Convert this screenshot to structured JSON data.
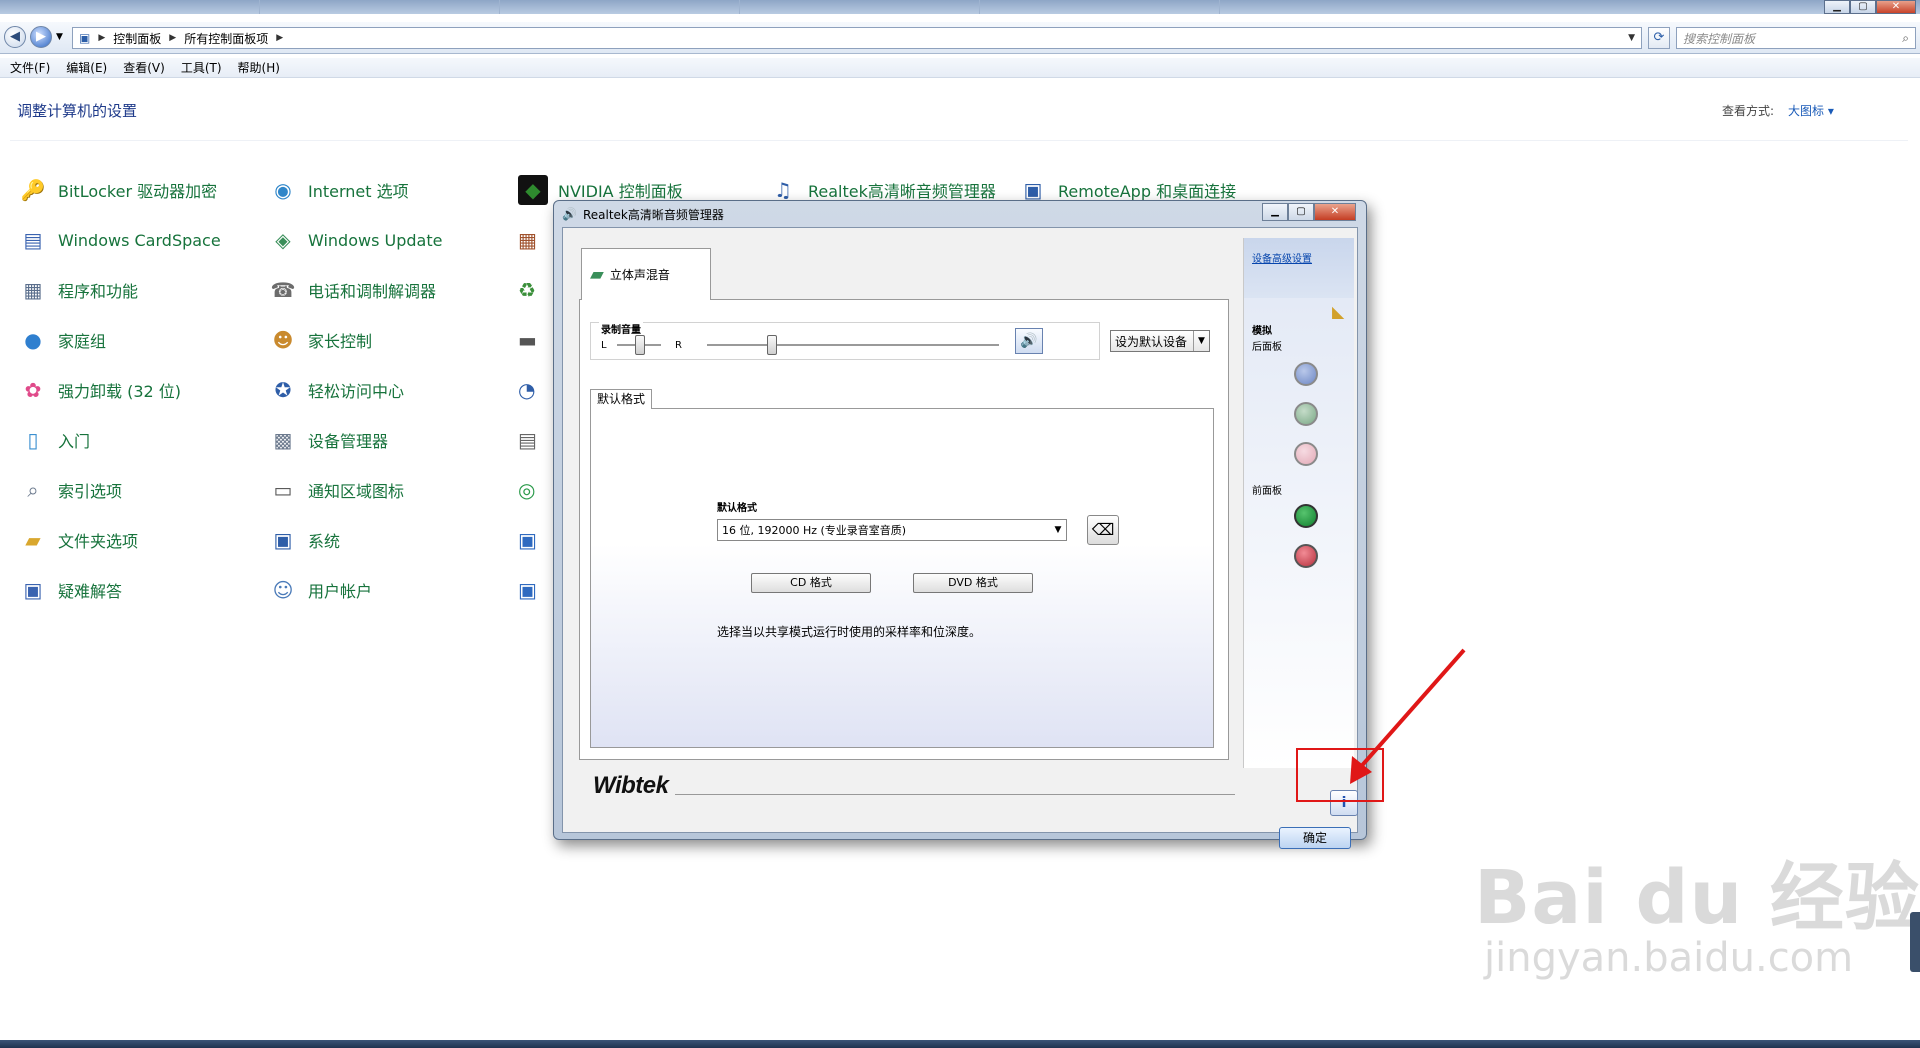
{
  "address": {
    "breadcrumbs": [
      "控制面板",
      "所有控制面板项"
    ],
    "search_placeholder": "搜索控制面板"
  },
  "menu": [
    "文件(F)",
    "编辑(E)",
    "查看(V)",
    "工具(T)",
    "帮助(H)"
  ],
  "control_panel": {
    "title": "调整计算机的设置",
    "view_label": "查看方式:",
    "view_value": "大图标 ▾",
    "items": [
      {
        "label": "BitLocker 驱动器加密",
        "icon": "bitlocker-icon"
      },
      {
        "label": "Windows CardSpace",
        "icon": "cardspace-icon"
      },
      {
        "label": "程序和功能",
        "icon": "programs-icon"
      },
      {
        "label": "家庭组",
        "icon": "homegroup-icon"
      },
      {
        "label": "强力卸载 (32 位)",
        "icon": "uninstall-icon"
      },
      {
        "label": "入门",
        "icon": "getting-started-icon"
      },
      {
        "label": "索引选项",
        "icon": "indexing-icon"
      },
      {
        "label": "文件夹选项",
        "icon": "folder-options-icon"
      },
      {
        "label": "疑难解答",
        "icon": "troubleshoot-icon"
      },
      {
        "label": "Internet 选项",
        "icon": "internet-options-icon"
      },
      {
        "label": "Windows Update",
        "icon": "windows-update-icon"
      },
      {
        "label": "电话和调制解调器",
        "icon": "phone-modem-icon"
      },
      {
        "label": "家长控制",
        "icon": "parental-control-icon"
      },
      {
        "label": "轻松访问中心",
        "icon": "ease-access-icon"
      },
      {
        "label": "设备管理器",
        "icon": "device-manager-icon"
      },
      {
        "label": "通知区域图标",
        "icon": "notification-icon"
      },
      {
        "label": "系统",
        "icon": "system-icon"
      },
      {
        "label": "用户帐户",
        "icon": "user-accounts-icon"
      },
      {
        "label": "NVIDIA 控制面板",
        "icon": "nvidia-icon"
      },
      {
        "label": "Realtek高清晰音频管理器",
        "icon": "realtek-icon"
      },
      {
        "label": "RemoteApp 和桌面连接",
        "icon": "remoteapp-icon"
      }
    ]
  },
  "dialog": {
    "title": "Realtek高清晰音频管理器",
    "tab_label": "立体声混音",
    "record_volume_label": "录制音量",
    "left": "L",
    "right": "R",
    "default_device": "设为默认设备",
    "format_tab": "默认格式",
    "format_label": "默认格式",
    "format_value": "16 位, 192000 Hz (专业录音室音质)",
    "cd_button": "CD 格式",
    "dvd_button": "DVD 格式",
    "description": "选择当以共享模式运行时使用的采样率和位深度。",
    "advanced_link": "设备高级设置",
    "analog_label": "模拟",
    "rear_panel_label": "后面板",
    "front_panel_label": "前面板",
    "brand": "Wibtek",
    "ok": "确定",
    "info_glyph": "i"
  },
  "watermark": {
    "main": "Bai du 经验",
    "sub": "jingyan.baidu.com"
  },
  "colors": {
    "link_green": "#17733c",
    "title_blue": "#1e3a8a",
    "annotation_red": "#e01717",
    "jack_blue": "#6d87c4",
    "jack_green": "#7aa886",
    "jack_pink": "#e2a9b6",
    "jack_front_green": "#0f7f2e",
    "jack_front_red": "#b5303d"
  }
}
